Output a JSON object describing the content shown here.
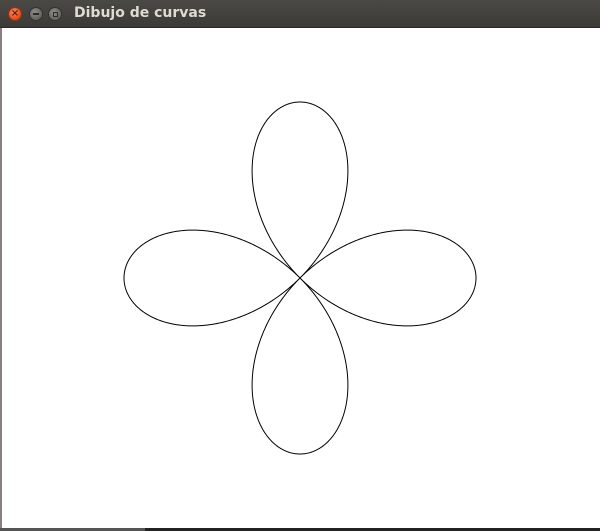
{
  "window": {
    "title": "Dibujo de curvas",
    "buttons": {
      "close": "×",
      "minimize": "minimize",
      "maximize": "maximize"
    }
  },
  "drawing": {
    "curve": "four-petal rose",
    "stroke_color": "#000000",
    "background_color": "#ffffff"
  }
}
